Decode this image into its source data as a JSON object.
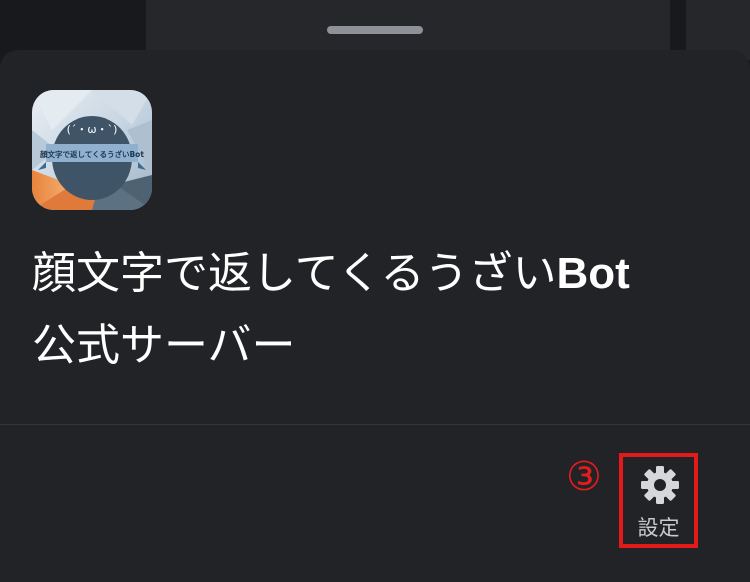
{
  "server": {
    "icon_caption": "顔文字で返してくるうざいBot",
    "icon_face": "(´・ω・`)",
    "name_line1": "顔文字で返してくるうざい",
    "name_bot": "Bot",
    "name_line2": "公式サーバー"
  },
  "actions": {
    "step_marker": "③",
    "settings_label": "設定",
    "settings_icon": "gear-icon"
  },
  "colors": {
    "sheet_bg": "#222326",
    "highlight": "#e31a1a",
    "label": "#c9cacd"
  }
}
